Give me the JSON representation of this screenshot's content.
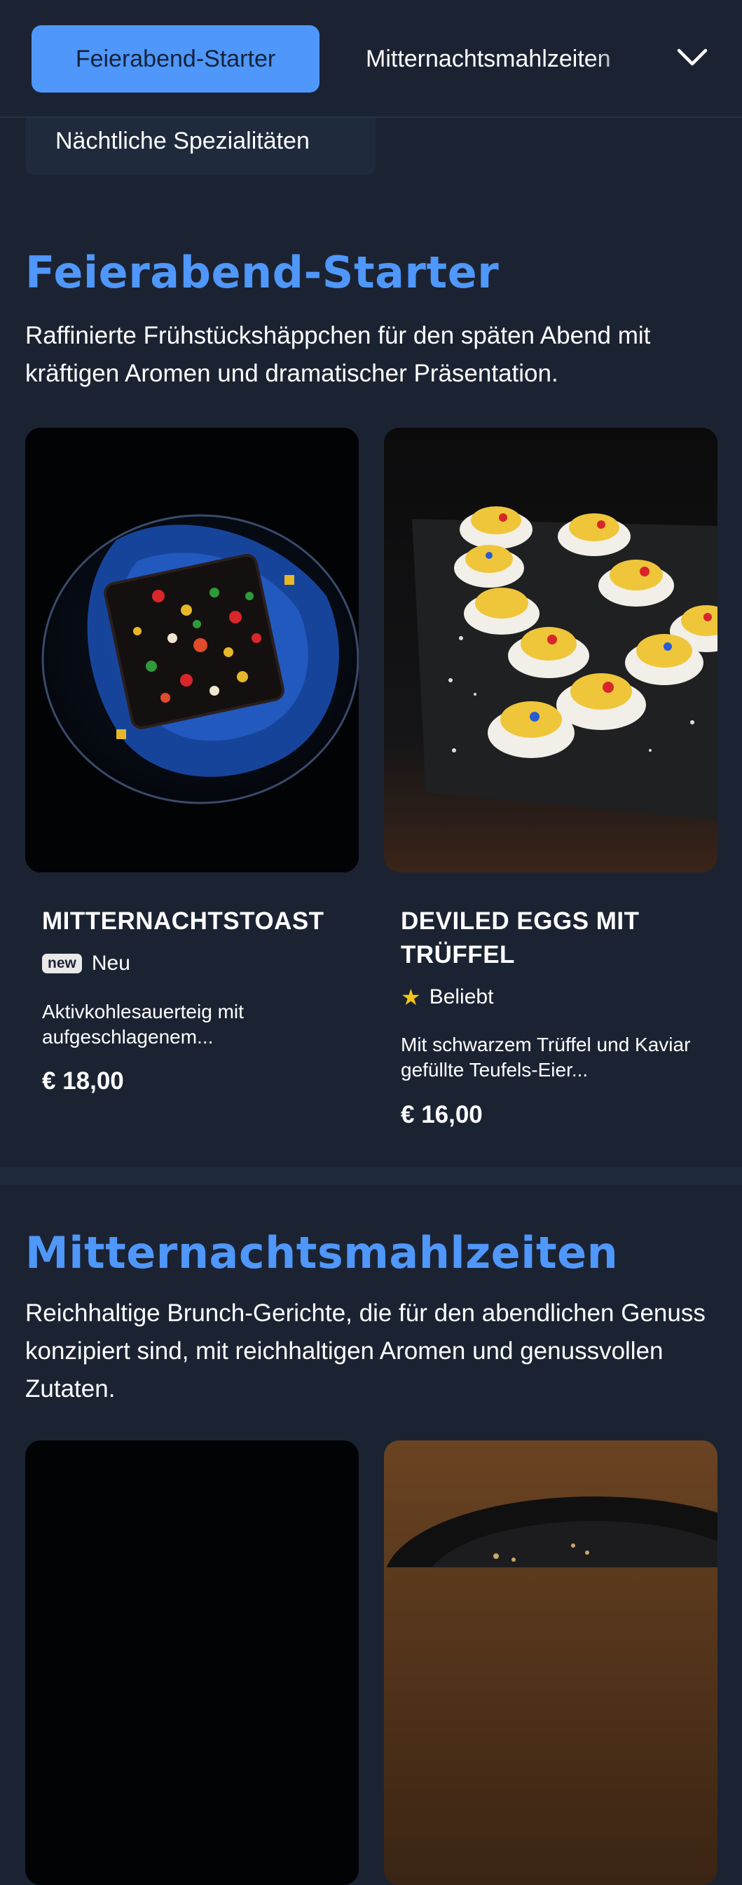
{
  "nav": {
    "active_tab": "Feierabend-Starter",
    "tabs": [
      "Feierabend-Starter",
      "Mitternachtsmahlzeiten",
      "Nächtliche Spezialitäten"
    ],
    "more_icon": "chevron-down-icon"
  },
  "colors": {
    "background": "#1b2333",
    "accent": "#4f97fa",
    "card_bg": "#1f2a3d",
    "star": "#f5c518"
  },
  "sections": [
    {
      "title": "Feierabend-Starter",
      "description": "Raffinierte Frühstückshäppchen für den späten Abend mit kräftigen Aromen und dramatischer Präsentation.",
      "items": [
        {
          "name": "MITTERNACHTSTOAST",
          "badge_icon": "new",
          "badge_label": "Neu",
          "description": "Aktivkohlesauerteig mit aufgeschlagenem...",
          "price": "€ 18,00"
        },
        {
          "name": "DEVILED EGGS MIT TRÜFFEL",
          "badge_icon": "star-icon",
          "badge_label": "Beliebt",
          "description": "Mit schwarzem Trüffel und Kaviar gefüllte Teufels-Eier...",
          "price": "€ 16,00"
        }
      ]
    },
    {
      "title": "Mitternachtsmahlzeiten",
      "description": "Reichhaltige Brunch-Gerichte, die für den abendlichen Genuss konzipiert sind, mit reichhaltigen Aromen und genussvollen Zutaten."
    }
  ]
}
